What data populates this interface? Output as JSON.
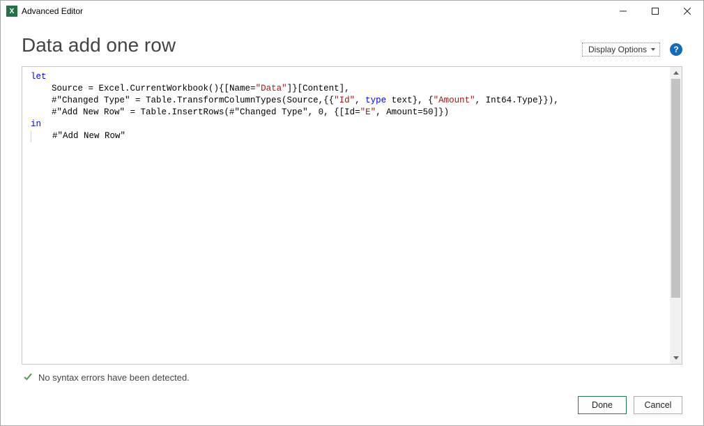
{
  "window": {
    "title": "Advanced Editor"
  },
  "header": {
    "page_title": "Data add one row",
    "display_options_label": "Display Options",
    "help_symbol": "?"
  },
  "code": {
    "let_kw": "let",
    "line1_a": "    Source = Excel.CurrentWorkbook(){[Name=",
    "line1_str": "\"Data\"",
    "line1_b": "]}[Content],",
    "line2_a": "    #\"Changed Type\" = Table.TransformColumnTypes(Source,{{",
    "line2_str1": "\"Id\"",
    "line2_mid1": ", ",
    "line2_type": "type",
    "line2_text": " text",
    "line2_mid2": "}, {",
    "line2_str2": "\"Amount\"",
    "line2_b": ", Int64.Type}}),",
    "line3_a": "    #\"Add New Row\" = Table.InsertRows(#\"Changed Type\", ",
    "line3_num": "0",
    "line3_mid": ", {[Id=",
    "line3_str": "\"E\"",
    "line3_mid2": ", Amount=",
    "line3_num2": "50",
    "line3_b": "]})",
    "in_kw": "in",
    "line_out": "    #\"Add New Row\""
  },
  "status": {
    "message": "No syntax errors have been detected."
  },
  "footer": {
    "done_label": "Done",
    "cancel_label": "Cancel"
  }
}
